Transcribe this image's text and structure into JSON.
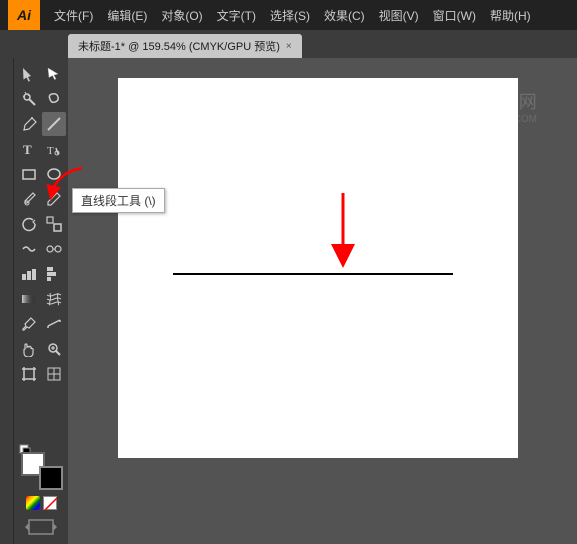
{
  "titlebar": {
    "logo": "Ai",
    "menus": [
      "文件(F)",
      "编辑(E)",
      "对象(O)",
      "文字(T)",
      "选择(S)",
      "效果(C)",
      "视图(V)",
      "窗口(W)",
      "帮助(H)"
    ]
  },
  "tab": {
    "label": "未标题-1* @ 159.54% (CMYK/GPU 预览)",
    "close": "×"
  },
  "tooltip": {
    "text": "直线段工具 (\\)"
  },
  "watermark": {
    "line1": "软件目字网",
    "line2": "WWW.RJZXW.COM"
  },
  "tools": {
    "rows": [
      [
        "arrow-select",
        "direct-select"
      ],
      [
        "magic-wand",
        "lasso"
      ],
      [
        "pen",
        "add-anchor"
      ],
      [
        "type",
        "line-segment"
      ],
      [
        "rectangle",
        "ellipse"
      ],
      [
        "paintbrush",
        "pencil"
      ],
      [
        "rotate",
        "scale"
      ],
      [
        "warp",
        "blend"
      ],
      [
        "column-graph",
        "bar-graph"
      ],
      [
        "gradient",
        "mesh"
      ],
      [
        "eyedropper",
        "measure"
      ],
      [
        "hand",
        "zoom"
      ],
      [
        "artboard",
        "slice"
      ]
    ]
  }
}
